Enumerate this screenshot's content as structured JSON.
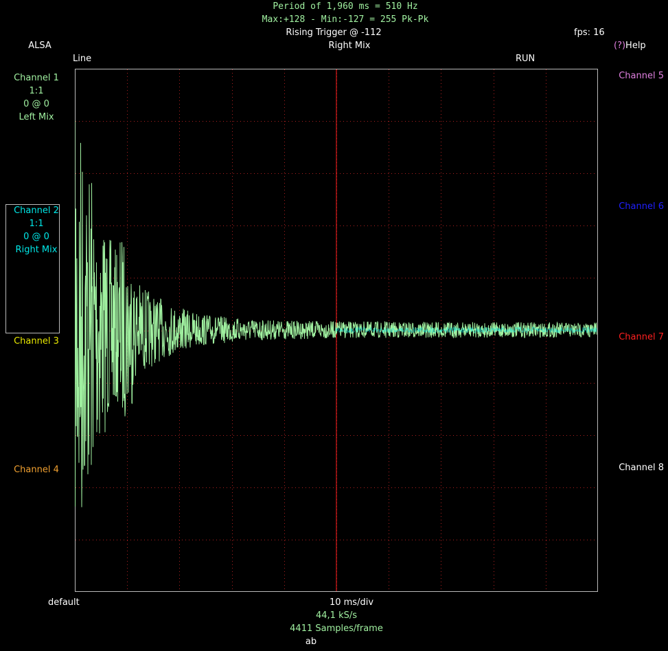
{
  "colors": {
    "green": "#a0f0a0",
    "cyan": "#00e8e8",
    "yellow": "#e8e800",
    "orange": "#f0a030",
    "magenta": "#e080e0",
    "blue": "#2020ff",
    "red": "#ff2020",
    "white": "#ffffff",
    "grid": "#b02020",
    "waveform": "#a0f0a0"
  },
  "header": {
    "period_line": "Period of 1,960 ms =   510 Hz",
    "maxmin_line": "Max:+128 - Min:-127 = 255 Pk-Pk",
    "trigger": "Rising Trigger @ -112",
    "fps": "fps: 16",
    "source": "ALSA",
    "trigger_source": "Right Mix",
    "help_mark": "(?)",
    "help_label": "Help",
    "input": "Line",
    "run_state": "RUN"
  },
  "channels_left": [
    {
      "name": "Channel 1",
      "scale": "1:1",
      "offset": "0 @ 0",
      "source": "Left Mix"
    },
    {
      "name": "Channel 2",
      "scale": "1:1",
      "offset": "0 @ 0",
      "source": "Right Mix"
    },
    {
      "name": "Channel 3"
    },
    {
      "name": "Channel 4"
    }
  ],
  "channels_right": [
    {
      "name": "Channel 5"
    },
    {
      "name": "Channel 6"
    },
    {
      "name": "Channel 7"
    },
    {
      "name": "Channel 8"
    }
  ],
  "footer": {
    "preset": "default",
    "timebase": "10 ms/div",
    "sample_rate": "44,1 kS/s",
    "samples_per_frame": "4411 Samples/frame",
    "bottom": "ab"
  }
}
